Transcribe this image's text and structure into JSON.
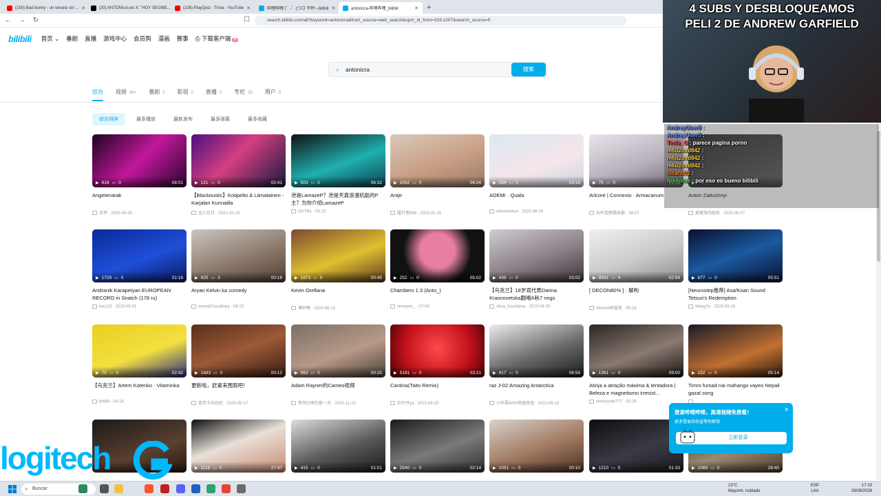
{
  "browser": {
    "tabs": [
      {
        "title": "(150) Bad bunny - un verano sin ...",
        "color": "#ff0000"
      },
      {
        "title": "(20) ANTONIcra en X: \"HOY SEGME...",
        "color": "#000000"
      },
      {
        "title": "(108) PlayQuiz - Trivia - YouTube",
        "color": "#ff0000"
      },
      {
        "title": "哔哩哔哩 (゜-゜)つロ 干杯~-bilibili",
        "color": "#00aeec"
      },
      {
        "title": "antonicra-哔哩哔哩_bilibili",
        "color": "#00aeec",
        "active": true
      }
    ],
    "new_tab": "+",
    "url": "search.bilibili.com/all?keyword=antonicra&from_source=web_search&spm_id_from=333.1007&search_source=5"
  },
  "header": {
    "logo": "bilibili",
    "nav": [
      "首页",
      "番剧",
      "直播",
      "游戏中心",
      "会员购",
      "漫画",
      "赛事"
    ],
    "download": "下载客户端",
    "download_badge": "新"
  },
  "search": {
    "query": "antonicra",
    "button": "搜索"
  },
  "tabs": [
    {
      "label": "综合",
      "count": ""
    },
    {
      "label": "视频",
      "count": "99+"
    },
    {
      "label": "番剧",
      "count": "0"
    },
    {
      "label": "影视",
      "count": "0"
    },
    {
      "label": "直播",
      "count": "0"
    },
    {
      "label": "专栏",
      "count": "23"
    },
    {
      "label": "用户",
      "count": "0"
    }
  ],
  "sorts": [
    "综合排序",
    "最多播放",
    "最新发布",
    "最多弹幕",
    "最多收藏"
  ],
  "videos": [
    {
      "views": "618",
      "danmaku": "0",
      "duration": "08:01",
      "title": "Angetenarak",
      "uploader": "舌帝",
      "date": "2025-04-30",
      "thumb": "linear-gradient(135deg,#1c0520,#c2189b 50%,#2a0530)"
    },
    {
      "views": "121",
      "danmaku": "0",
      "duration": "02:41",
      "title": "【Blackoustic】Kotipelto & Liimatainen -Karjalan Kunnailla",
      "uploader": "金小日月",
      "date": "2022-10-18",
      "thumb": "linear-gradient(135deg,#4a1080,#d44080 45%,#1a1a40)"
    },
    {
      "views": "503",
      "danmaku": "0",
      "duration": "06:32",
      "title": "泄是LamazeP？泄是天真浪漫机能的P主？为你介绍LamazeP",
      "uploader": "GKTRs",
      "date": "08-23",
      "thumb": "linear-gradient(160deg,#111,#20b0b0 55%,#0c4050)"
    },
    {
      "views": "1002",
      "danmaku": "0",
      "duration": "06:04",
      "title": "Antje",
      "uploader": "履行者666",
      "date": "2023-01-15",
      "thumb": "linear-gradient(160deg,#d9c8b8,#c89e84 55%,#9a7a66)"
    },
    {
      "views": "264",
      "danmaku": "0",
      "duration": "03:19",
      "title": "ADEMI · Quala",
      "uploader": "mikomeikon",
      "date": "2025-06-04",
      "thumb": "linear-gradient(160deg,#dde8f2,#f5e6ea 60%,#c7d3e0)"
    },
    {
      "views": "75",
      "danmaku": "0",
      "duration": "01:43",
      "title": "Arlcore | Connexio · Armacanum",
      "uploader": "杂杆杏野猫本猫",
      "date": "08-07",
      "thumb": "linear-gradient(160deg,#e8e4ea,#b8b0bb 55%,#706670)"
    },
    {
      "views": "",
      "danmaku": "",
      "duration": "",
      "title": "Anton Zaitushnyi",
      "uploader": "爱健身的屁后",
      "date": "2025-05-07",
      "thumb": "linear-gradient(160deg,#333,#666)"
    },
    {
      "views": "1729",
      "danmaku": "0",
      "duration": "01:16",
      "title": "Andranik Karapetyan EUROPEAN RECORD in Snatch (178 ru)",
      "uploader": "lwcz13",
      "date": "2023-05-01",
      "thumb": "linear-gradient(160deg,#0a2a9a,#1f4fd8 55%,#0a1a60)"
    },
    {
      "views": "925",
      "danmaku": "3",
      "duration": "00:18",
      "title": "Aryan Kelvin ka comedy",
      "uploader": "arvindChoudhary",
      "date": "08-23",
      "thumb": "linear-gradient(160deg,#c9c6c2,#8d7a6c 55%,#4f3f35)"
    },
    {
      "views": "1873",
      "danmaku": "0",
      "duration": "00:45",
      "title": "Kevin Orellana",
      "uploader": "偶杯睡",
      "date": "2024-06-13",
      "thumb": "linear-gradient(160deg,#7b4a30,#e0c030 55%,#5c3b22)"
    },
    {
      "views": "252",
      "danmaku": "0",
      "duration": "05:02",
      "title": "Chambers 1.3 (Anto_)",
      "uploader": "sheepex_",
      "date": "07-06",
      "thumb": "radial-gradient(circle at 50% 40%,#e77fa2 0,#e77fa2 30%,#111 60%)"
    },
    {
      "views": "439",
      "danmaku": "0",
      "duration": "03:02",
      "title": "【乌克兰】18岁双代表Darina Krasnovetska翻唱A秋7 nngs",
      "uploader": "Alisa_Kozhikina",
      "date": "2020-04-20",
      "thumb": "linear-gradient(160deg,#d0ccd4,#8a7f86 55%,#3e3439)"
    },
    {
      "views": "8931",
      "danmaku": "4",
      "duration": "02:54",
      "title": "[ DECON80% ] · 解构",
      "uploader": "Vincent树曼琉",
      "date": "08-24",
      "thumb": "linear-gradient(160deg,#f0f0f0,#c9c9c9 55%,#8a8a8a)"
    },
    {
      "views": "877",
      "danmaku": "0",
      "duration": "05:51",
      "title": "[Neurostep推荐] Asa/Koan Sound · Tetsuo's Redemption",
      "uploader": "WangYo",
      "date": "2025-02-16",
      "thumb": "linear-gradient(160deg,#0a1030,#1b5aa0 50%,#0a1030)"
    },
    {
      "views": "75",
      "danmaku": "0",
      "duration": "02:42",
      "title": "【乌克兰】Artem Kotenko · Vitaminka",
      "uploader": "brit99",
      "date": "04-18",
      "thumb": "linear-gradient(160deg,#e8d020,#f3e040 55%,#2a2a80)"
    },
    {
      "views": "1683",
      "danmaku": "0",
      "duration": "00:12",
      "title": "更新啦，赶紧来围观吧！",
      "uploader": "蓝欢卡拉奶奶",
      "date": "2025-05-17",
      "thumb": "linear-gradient(160deg,#5a2e1a,#9b5a38 50%,#3a1c10)"
    },
    {
      "views": "993",
      "danmaku": "0",
      "duration": "00:25",
      "title": "Adam Rayner的Cameo视频",
      "uploader": "等风归来的那一天",
      "date": "2024-11-23",
      "thumb": "linear-gradient(160deg,#7a7068,#b89a86 55%,#4a4038)"
    },
    {
      "views": "5191",
      "danmaku": "0",
      "duration": "03:21",
      "title": "Cantina(Taito Remix)",
      "uploader": "抄升丹ya",
      "date": "2022-06-23",
      "thumb": "radial-gradient(circle at 50% 45%,#ff4a4a,#c0101a 60%,#4a0508)"
    },
    {
      "views": "417",
      "danmaku": "0",
      "duration": "06:59",
      "title": "raz J-02:Amazing Antarctica",
      "uploader": "小所属4000就被审查",
      "date": "2022-06-12",
      "thumb": "linear-gradient(160deg,#ececec,#6a6a6a 55%,#1a1a1a)"
    },
    {
      "views": "1361",
      "danmaku": "0",
      "duration": "09:00",
      "title": "Atinja a atração máxima & tentadora | Beleza e magnetismo irresist...",
      "uploader": "cherrycafe777",
      "date": "02-26",
      "thumb": "linear-gradient(160deg,#2a2624,#8a7a70 55%,#1a1614)"
    },
    {
      "views": "152",
      "danmaku": "0",
      "duration": "05:14",
      "title": "Timro fursad nai mahango vayeo Nepali gazal song",
      "uploader": "",
      "date": "",
      "thumb": "linear-gradient(160deg,#1a1a28,#c27030 60%,#2a1a10)"
    },
    {
      "views": "",
      "danmaku": "",
      "duration": "",
      "title": "",
      "uploader": "",
      "date": "",
      "thumb": "linear-gradient(160deg,#1a1a1a,#5a4030 60%,#2a1a10)"
    },
    {
      "views": "1116",
      "danmaku": "0",
      "duration": "27:47",
      "title": "",
      "uploader": "",
      "date": "",
      "thumb": "linear-gradient(160deg,#101010,#e8e0d8 45%,#c88a70)"
    },
    {
      "views": "415",
      "danmaku": "0",
      "duration": "01:01",
      "title": "",
      "uploader": "",
      "date": "",
      "thumb": "linear-gradient(160deg,#dcdcdc,#5a5a5a 55%,#1a1a1a)"
    },
    {
      "views": "2540",
      "danmaku": "0",
      "duration": "02:14",
      "title": "",
      "uploader": "",
      "date": "",
      "thumb": "linear-gradient(160deg,#1c1c1c,#7a7a7a 55%,#303030)"
    },
    {
      "views": "1051",
      "danmaku": "0",
      "duration": "00:10",
      "title": "",
      "uploader": "",
      "date": "",
      "thumb": "linear-gradient(160deg,#d8d2cc,#a07860 55%,#4a3024)"
    },
    {
      "views": "1210",
      "danmaku": "0",
      "duration": "01:33",
      "title": "",
      "uploader": "",
      "date": "",
      "thumb": "linear-gradient(160deg,#0e0e10,#3a3a44 55%,#1a1a1e)"
    },
    {
      "views": "1069",
      "danmaku": "0",
      "duration": "28:40",
      "title": "",
      "uploader": "",
      "date": "",
      "thumb": "linear-gradient(160deg,#2a2a2a,#9a8a70 55%,#4a3a2a)"
    }
  ],
  "overlay": {
    "headline_line1": "4 SUBS Y DESBLOQUEAMOS",
    "headline_line2": "PELI 2 DE ANDREW GARFIELD"
  },
  "chat": [
    {
      "user": "AndreyUser8",
      "msg": "",
      "color": "#6a8cff"
    },
    {
      "user": "AndreyUser5",
      "msg": "",
      "color": "#6a8cff"
    },
    {
      "user": "Tesla_G",
      "msg": "parece pagina porno",
      "color": "#ff4040"
    },
    {
      "user": "m6u2oxd842",
      "msg": "",
      "color": "#ffd040"
    },
    {
      "user": "m6u2oxd842",
      "msg": "",
      "color": "#ffd040"
    },
    {
      "user": "m6u2oxd842",
      "msg": "",
      "color": "#ffd040"
    },
    {
      "user": "lillian902",
      "msg": "",
      "color": "#ff8a40"
    },
    {
      "user": "Nikiforas",
      "msg": "por eso es bueno bilibili",
      "color": "#50e050"
    }
  ],
  "popup": {
    "title": "登录哔哩哔哩，高清视频免费看！",
    "subtitle": "更多登录后权益等你解锁",
    "button": "立即登录",
    "close": "×"
  },
  "brand": {
    "logitech": "logitech"
  },
  "taskbar": {
    "search": "Buscar",
    "weather_temp": "23°C",
    "weather_desc": "Mayorm. nublado",
    "lang": "ESP",
    "lang2": "LAA",
    "time": "17:10",
    "date": "26/08/2026"
  },
  "colors": {
    "accent": "#00aeec",
    "pink": "#ff6699"
  }
}
